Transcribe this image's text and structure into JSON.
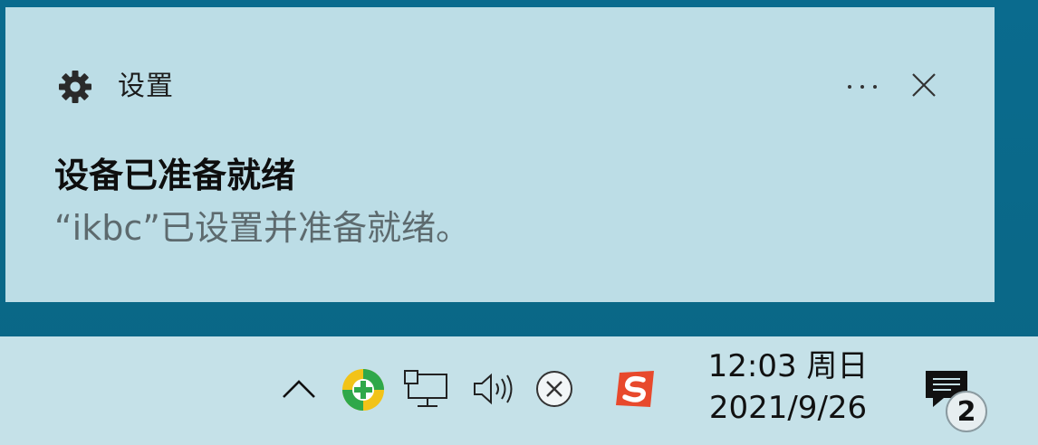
{
  "toast": {
    "app_name": "设置",
    "app_icon": "gear-icon",
    "more_icon": "more-horizontal-icon",
    "close_icon": "close-icon",
    "title": "设备已准备就绪",
    "body": "“ikbc”已设置并准备就绪。"
  },
  "taskbar": {
    "tray_icons": [
      "chevron-up-icon",
      "360-security-icon",
      "network-icon",
      "volume-icon",
      "x-circle-icon",
      "sogou-input-icon"
    ],
    "clock": {
      "time": "12:03 周日",
      "date": "2021/9/26"
    },
    "notification_count": "2"
  },
  "colors": {
    "toast_bg": "#bcdde6",
    "desktop_bg": "#0a6b8e",
    "taskbar_bg": "#c5e1e8",
    "sogou_red": "#e8492c",
    "icon_360_green": "#2fa84a",
    "icon_360_yellow": "#f2c318"
  }
}
